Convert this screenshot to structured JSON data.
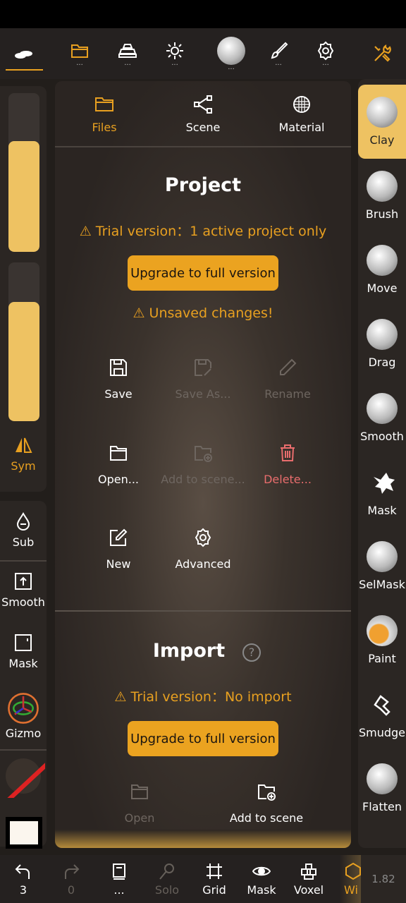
{
  "colors": {
    "accent": "#e8a020",
    "danger": "#e96d6d",
    "selected_tool": "#eec262"
  },
  "topbar": {
    "items": [
      {
        "icon": "clouds-icon",
        "dots": ""
      },
      {
        "icon": "folder-icon",
        "dots": "..."
      },
      {
        "icon": "gold-bars-icon",
        "dots": "..."
      },
      {
        "icon": "sun-icon",
        "dots": "..."
      },
      {
        "icon": "sphere-material-icon",
        "dots": "..."
      },
      {
        "icon": "paint-brush-icon",
        "dots": "..."
      },
      {
        "icon": "gear-icon",
        "dots": "..."
      },
      {
        "icon": "tools-icon",
        "dots": ""
      }
    ]
  },
  "left": {
    "slider1": 0.7,
    "slider2": 0.75,
    "sym": "Sym",
    "sub": "Sub",
    "smooth": "Smooth",
    "mask": "Mask",
    "gizmo": "Gizmo"
  },
  "panel": {
    "tabs": [
      {
        "label": "Files",
        "icon": "folder-icon"
      },
      {
        "label": "Scene",
        "icon": "share-nodes-icon"
      },
      {
        "label": "Material",
        "icon": "sphere-grid-icon"
      }
    ],
    "project": {
      "title": "Project",
      "trial": "⚠ Trial version：1 active project only",
      "upgrade": "Upgrade to full version",
      "unsaved": "⚠ Unsaved changes!",
      "actions": [
        {
          "label": "Save"
        },
        {
          "label": "Save As..."
        },
        {
          "label": "Rename"
        },
        {
          "label": "Open..."
        },
        {
          "label": "Add to scene..."
        },
        {
          "label": "Delete..."
        },
        {
          "label": "New"
        },
        {
          "label": "Advanced"
        }
      ]
    },
    "import": {
      "title": "Import",
      "help": "?",
      "trial": "⚠ Trial version：No import",
      "upgrade": "Upgrade to full version",
      "open": "Open",
      "add": "Add to scene"
    }
  },
  "right": {
    "tools": [
      "Clay",
      "Brush",
      "Move",
      "Drag",
      "Smooth",
      "Mask",
      "SelMask",
      "Paint",
      "Smudge",
      "Flatten"
    ]
  },
  "bottom": {
    "undo": "3",
    "redo": "0",
    "doc": "...",
    "solo": "Solo",
    "grid": "Grid",
    "mask": "Mask",
    "voxel": "Voxel",
    "wire": "Wi",
    "version": "1.82"
  }
}
